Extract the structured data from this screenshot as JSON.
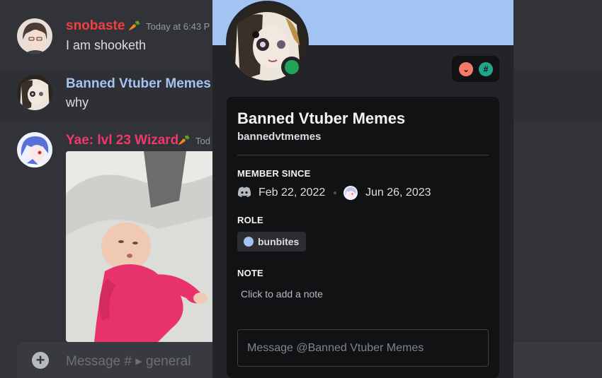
{
  "chat": {
    "messages": [
      {
        "username": "snobaste",
        "username_color": "#f23f43",
        "timestamp": "Today at 6:43 P",
        "text": "I am shooketh"
      },
      {
        "username": "Banned Vtuber Memes",
        "username_color": "#a3c4f3",
        "text": "why"
      },
      {
        "username": "Yae: lvl 23 Wizard",
        "username_color": "#f0386b",
        "timestamp": "Tod"
      }
    ],
    "composer_placeholder": "Message # ▸ general"
  },
  "profile": {
    "display_name": "Banned Vtuber Memes",
    "username": "bannedvtmemes",
    "status": "online",
    "banner_color": "#a3c4f3",
    "badges": [
      "hypesquad-icon",
      "hashtag-icon"
    ],
    "member_since_label": "MEMBER SINCE",
    "discord_since": "Feb 22, 2022",
    "server_since": "Jun 26, 2023",
    "role_label": "ROLE",
    "role": {
      "name": "bunbites",
      "color": "#a3c4f3"
    },
    "note_label": "NOTE",
    "note_placeholder": "Click to add a note",
    "dm_placeholder": "Message @Banned Vtuber Memes"
  }
}
